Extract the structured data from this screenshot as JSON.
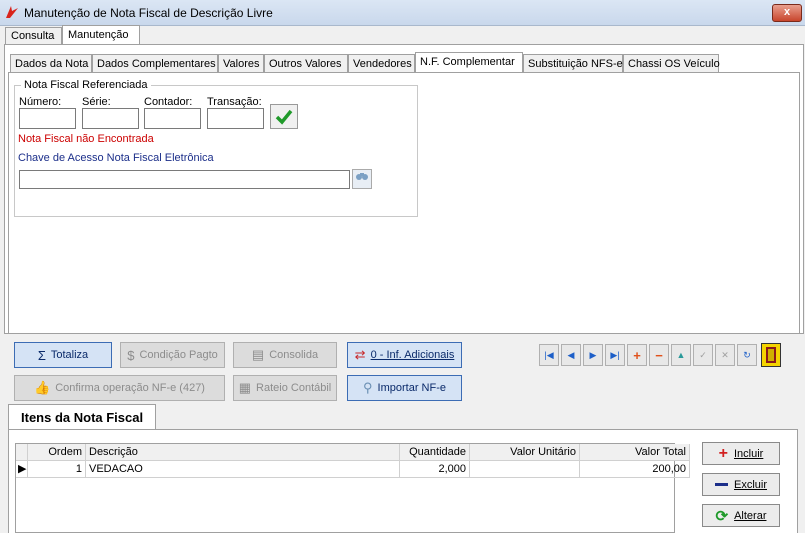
{
  "window": {
    "title": "Manutenção de Nota Fiscal de Descrição Livre",
    "close_glyph": "x"
  },
  "top_tabs": [
    {
      "label": "Consulta"
    },
    {
      "label": "Manutenção"
    }
  ],
  "inner_tabs": [
    {
      "label": "Dados da Nota"
    },
    {
      "label": "Dados Complementares"
    },
    {
      "label": "Valores"
    },
    {
      "label": "Outros Valores"
    },
    {
      "label": "Vendedores"
    },
    {
      "label": "N.F. Complementar"
    },
    {
      "label": "Substituição NFS-e"
    },
    {
      "label": "Chassi OS Veículo"
    }
  ],
  "nf_ref": {
    "group_title": "Nota Fiscal Referenciada",
    "numero_label": "Número:",
    "serie_label": "Série:",
    "contador_label": "Contador:",
    "transacao_label": "Transação:",
    "numero_value": "",
    "serie_value": "",
    "contador_value": "",
    "transacao_value": "",
    "not_found": "Nota Fiscal não Encontrada",
    "chave_label": "Chave de Acesso Nota Fiscal Eletrônica",
    "chave_value": ""
  },
  "buttons": {
    "totaliza": "Totaliza",
    "condicao_pagto": "Condição Pagto",
    "consolida": "Consolida",
    "inf_adicionais": "0 - Inf. Adicionais",
    "confirma_nfe": "Confirma operação NF-e (427)",
    "rateio_contabil": "Rateio Contábil",
    "importar_nfe": "Importar NF-e"
  },
  "items": {
    "section_title": "Itens da Nota Fiscal",
    "columns": [
      "Ordem",
      "Descrição",
      "Quantidade",
      "Valor Unitário",
      "Valor Total"
    ],
    "rows": [
      {
        "ordem": "1",
        "descricao": "VEDACAO",
        "quantidade": "2,000",
        "valor_unitario": "",
        "valor_total": "200,00"
      }
    ]
  },
  "side_buttons": {
    "incluir": "Incluir",
    "excluir": "Excluir",
    "alterar": "Alterar"
  },
  "colors": {
    "accent": "#3c6cb4",
    "error": "#cc0000",
    "link": "#1c2f8a"
  }
}
